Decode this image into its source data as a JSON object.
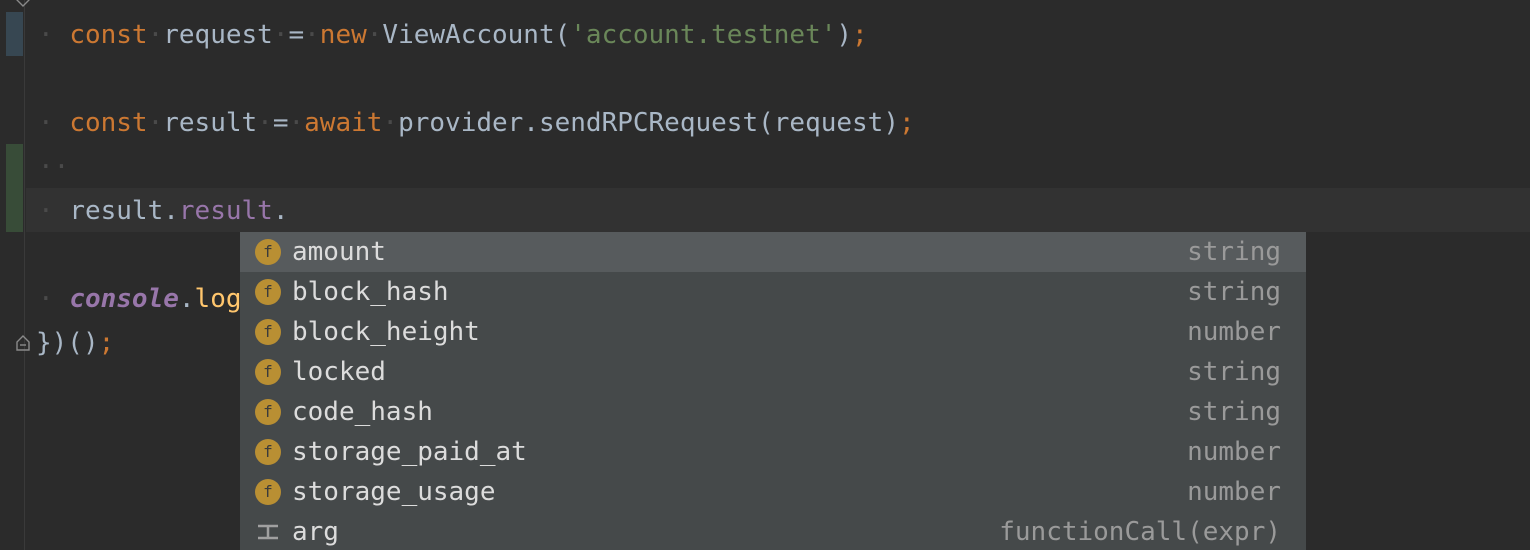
{
  "editor": {
    "lines": {
      "request": {
        "kw_const": "const",
        "var": "request",
        "eq": "=",
        "kw_new": "new",
        "cls": "ViewAccount(",
        "arg": "'account.testnet'",
        "close": ")",
        "semi": ";"
      },
      "result": {
        "kw_const": "const",
        "var": "result",
        "eq": "=",
        "kw_await": "await",
        "call": "provider.sendRPCRequest(request)",
        "semi": ";"
      },
      "access": {
        "obj": "result",
        "dot1": ".",
        "field": "result",
        "dot2": "."
      },
      "console": {
        "obj": "console",
        "dot": ".",
        "method": "log"
      },
      "close": {
        "text": "})()",
        "semi": ";"
      }
    }
  },
  "completion": {
    "items": [
      {
        "icon": "f",
        "label": "amount",
        "type": "string",
        "selected": true
      },
      {
        "icon": "f",
        "label": "block_hash",
        "type": "string"
      },
      {
        "icon": "f",
        "label": "block_height",
        "type": "number"
      },
      {
        "icon": "f",
        "label": "locked",
        "type": "string"
      },
      {
        "icon": "f",
        "label": "code_hash",
        "type": "string"
      },
      {
        "icon": "f",
        "label": "storage_paid_at",
        "type": "number"
      },
      {
        "icon": "f",
        "label": "storage_usage",
        "type": "number"
      },
      {
        "icon": "template-icon",
        "label": "arg",
        "type": "functionCall(expr)"
      }
    ]
  },
  "colors": {
    "background": "#2b2b2b",
    "keyword": "#cc7832",
    "string": "#6a8759",
    "field": "#9876aa",
    "function": "#ffc66d",
    "popup": "#45494a",
    "popup_selected": "#575b5d",
    "field_icon": "#b98f33"
  }
}
